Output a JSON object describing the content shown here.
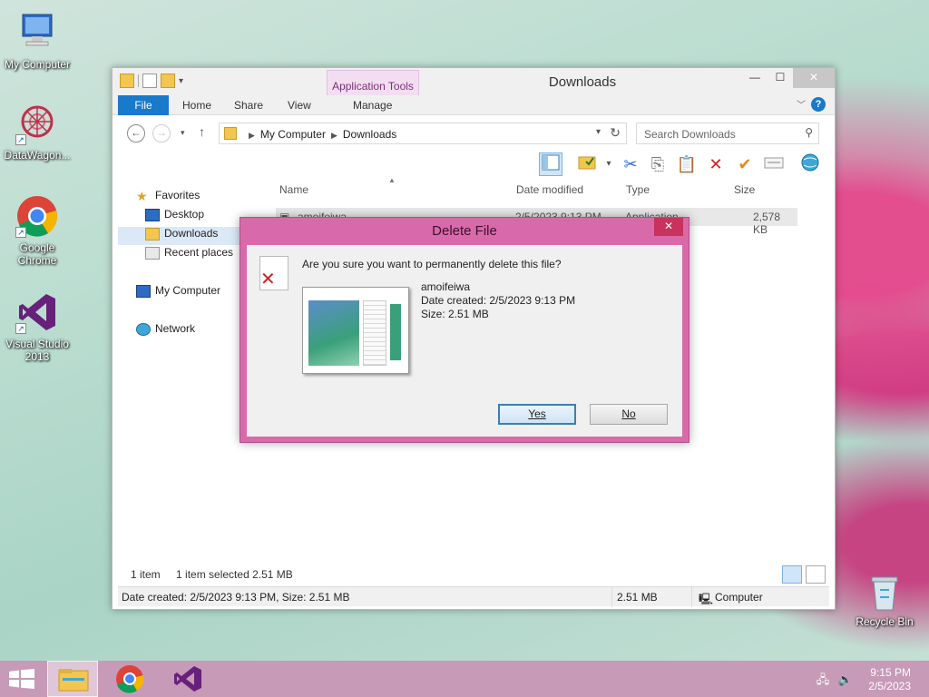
{
  "desktop": {
    "icons": [
      {
        "label": "My Computer"
      },
      {
        "label": "DataWagon..."
      },
      {
        "label": "Google Chrome"
      },
      {
        "label": "Visual Studio 2013"
      }
    ],
    "recycle_bin": "Recycle Bin"
  },
  "explorer": {
    "title": "Downloads",
    "context_tab": "Application Tools",
    "tabs": {
      "file": "File",
      "home": "Home",
      "share": "Share",
      "view": "View",
      "manage": "Manage"
    },
    "address": {
      "crumb1": "My Computer",
      "crumb2": "Downloads"
    },
    "search_placeholder": "Search Downloads",
    "nav": {
      "favorites": "Favorites",
      "desktop": "Desktop",
      "downloads": "Downloads",
      "recent": "Recent places",
      "computer": "My Computer",
      "network": "Network"
    },
    "columns": {
      "name": "Name",
      "date": "Date modified",
      "type": "Type",
      "size": "Size"
    },
    "files": [
      {
        "name": "amoifeiwa",
        "date": "2/5/2023 9:13 PM",
        "type": "Application",
        "size": "2,578 KB"
      }
    ],
    "status": {
      "count": "1 item",
      "selected": "1 item selected  2.51 MB"
    },
    "details": {
      "info": "Date created: 2/5/2023 9:13 PM, Size: 2.51 MB",
      "size": "2.51 MB",
      "location": "Computer"
    }
  },
  "dialog": {
    "title": "Delete File",
    "question": "Are you sure you want to permanently delete this file?",
    "file_name": "amoifeiwa",
    "date_created": "Date created: 2/5/2023 9:13 PM",
    "size": "Size: 2.51 MB",
    "yes_label": "Yes",
    "no_label": "No"
  },
  "taskbar": {
    "time": "9:15 PM",
    "date": "2/5/2023"
  },
  "colors": {
    "accent": "#1979ca",
    "dialog_frame": "#d96aa9",
    "taskbar": "#c79ab7"
  }
}
